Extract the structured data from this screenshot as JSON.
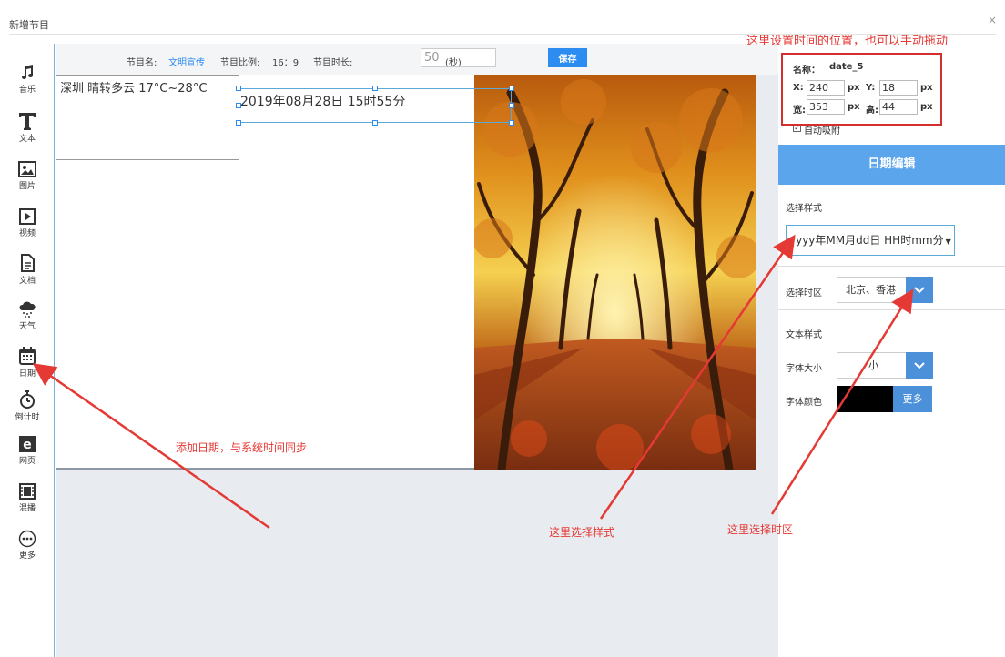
{
  "dialog": {
    "title": "新增节目",
    "close": "×"
  },
  "toolbar": {
    "name_label": "节目名:",
    "name_value": "文明宣传",
    "ratio_label": "节目比例:",
    "ratio_value": "16：9",
    "duration_label": "节目时长:",
    "duration_value": "50",
    "unit": "(秒)",
    "save": "保存"
  },
  "sidebar": {
    "items": [
      {
        "label": "音乐",
        "icon": "music-note-icon"
      },
      {
        "label": "文本",
        "icon": "text-t-icon"
      },
      {
        "label": "图片",
        "icon": "image-icon"
      },
      {
        "label": "视频",
        "icon": "video-play-icon"
      },
      {
        "label": "文档",
        "icon": "document-icon"
      },
      {
        "label": "天气",
        "icon": "weather-cloud-icon"
      },
      {
        "label": "日期",
        "icon": "calendar-icon"
      },
      {
        "label": "倒计时",
        "icon": "stopwatch-icon"
      },
      {
        "label": "网页",
        "icon": "web-e-icon"
      },
      {
        "label": "混播",
        "icon": "film-icon"
      },
      {
        "label": "更多",
        "icon": "more-dots-icon"
      }
    ]
  },
  "canvas": {
    "weather_text": "深圳  晴转多云   17°C~28°C",
    "date_text": "2019年08月28日  15时55分"
  },
  "panel": {
    "name_label": "名称：",
    "name_value": "date_5",
    "x_label": "X:",
    "x_value": "240",
    "y_label": "Y:",
    "y_value": "18",
    "w_label": "宽:",
    "w_value": "353",
    "h_label": "高:",
    "h_value": "44",
    "unit": "px",
    "auto_snap": "自动吸附",
    "header": "日期编辑",
    "style_label": "选择样式",
    "style_value": "yyyy年MM月dd日 HH时mm分",
    "timezone_label": "选择时区",
    "timezone_value": "北京、香港",
    "text_style_label": "文本样式",
    "font_size_label": "字体大小",
    "font_size_value": "小",
    "font_color_label": "字体颜色",
    "font_color": "#000000",
    "more": "更多"
  },
  "annotations": {
    "position_note": "这里设置时间的位置，也可以手动拖动",
    "add_date_note": "添加日期，与系统时间同步",
    "style_note": "这里选择样式",
    "timezone_note": "这里选择时区"
  }
}
